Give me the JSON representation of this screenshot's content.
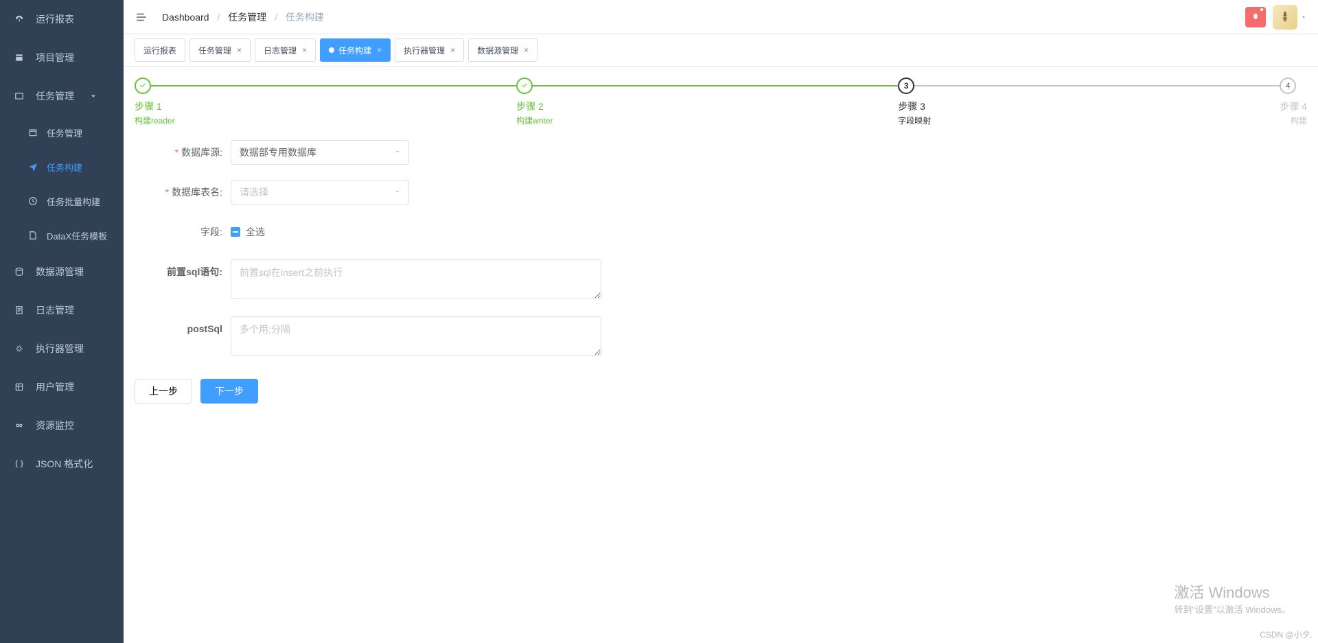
{
  "sidebar": {
    "items": [
      {
        "label": "运行报表",
        "icon": "dashboard"
      },
      {
        "label": "项目管理",
        "icon": "project"
      },
      {
        "label": "任务管理",
        "icon": "task",
        "expandable": true
      },
      {
        "label": "数据源管理",
        "icon": "datasource"
      },
      {
        "label": "日志管理",
        "icon": "log"
      },
      {
        "label": "执行器管理",
        "icon": "executor"
      },
      {
        "label": "用户管理",
        "icon": "user"
      },
      {
        "label": "资源监控",
        "icon": "monitor"
      },
      {
        "label": "JSON 格式化",
        "icon": "json"
      }
    ],
    "subItems": [
      {
        "label": "任务管理",
        "icon": "calendar"
      },
      {
        "label": "任务构建",
        "icon": "plane",
        "active": true
      },
      {
        "label": "任务批量构建",
        "icon": "batch"
      },
      {
        "label": "DataX任务模板",
        "icon": "template"
      }
    ]
  },
  "breadcrumb": {
    "root": "Dashboard",
    "parent": "任务管理",
    "current": "任务构建"
  },
  "tabs": [
    {
      "label": "运行报表",
      "closable": false
    },
    {
      "label": "任务管理",
      "closable": true
    },
    {
      "label": "日志管理",
      "closable": true
    },
    {
      "label": "任务构建",
      "closable": true,
      "active": true
    },
    {
      "label": "执行器管理",
      "closable": true
    },
    {
      "label": "数据源管理",
      "closable": true
    }
  ],
  "steps": [
    {
      "title": "步骤 1",
      "desc": "构建reader",
      "state": "done"
    },
    {
      "title": "步骤 2",
      "desc": "构建writer",
      "state": "done"
    },
    {
      "title": "步骤 3",
      "desc": "字段映射",
      "state": "cur",
      "num": "3"
    },
    {
      "title": "步骤 4",
      "desc": "构建",
      "state": "pend",
      "num": "4"
    }
  ],
  "form": {
    "db_source": {
      "label": "数据库源:",
      "value": "数据部专用数据库",
      "required": true
    },
    "db_table": {
      "label": "数据库表名:",
      "placeholder": "请选择",
      "required": true
    },
    "fields": {
      "label": "字段:",
      "checkbox_label": "全选"
    },
    "pre_sql": {
      "label": "前置sql语句:",
      "placeholder": "前置sql在insert之前执行"
    },
    "post_sql": {
      "label": "postSql",
      "placeholder": "多个用;分隔"
    }
  },
  "buttons": {
    "prev": "上一步",
    "next": "下一步"
  },
  "watermark": {
    "title": "激活 Windows",
    "sub": "转到\"设置\"以激活 Windows。"
  },
  "csdn": "CSDN @小夕."
}
